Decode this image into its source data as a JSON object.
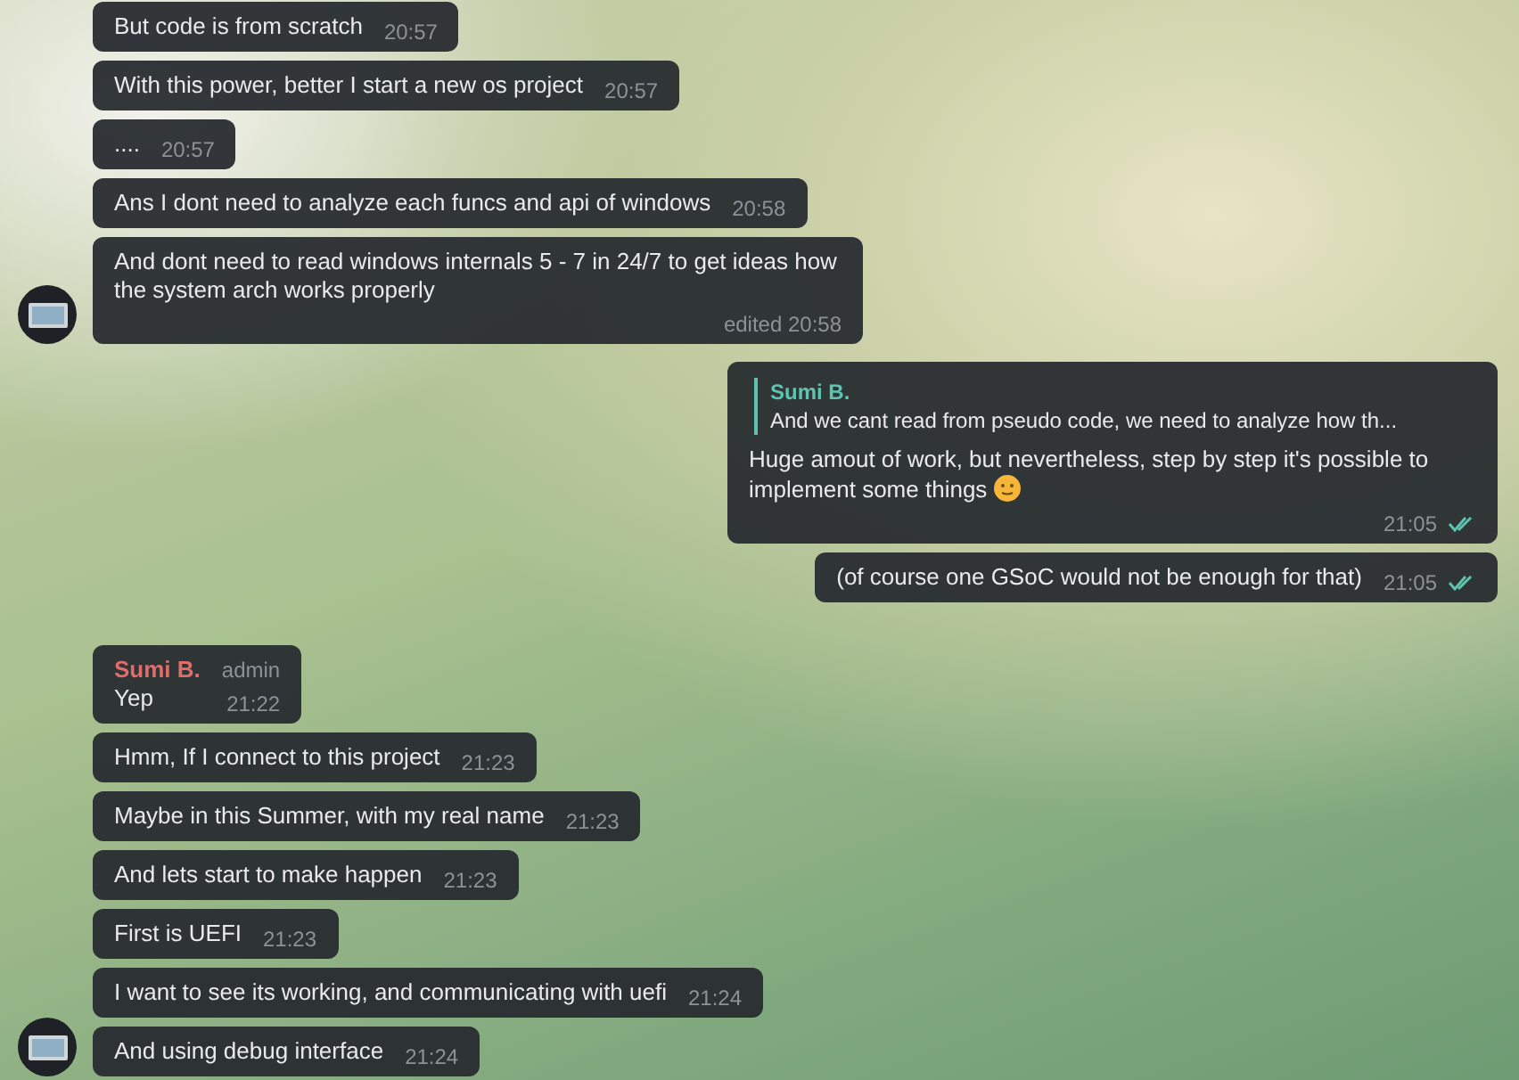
{
  "groups": [
    {
      "kind": "incoming",
      "messages": [
        {
          "text": "But code is from scratch",
          "time": "20:57"
        },
        {
          "text": "With this power, better I start a new os project",
          "time": "20:57"
        },
        {
          "text": "....",
          "time": "20:57"
        },
        {
          "text": "Ans I dont need to analyze each funcs and api of windows",
          "time": "20:58"
        },
        {
          "text": "And dont need to read windows internals 5 - 7 in 24/7 to get ideas how the system arch works properly",
          "time": "edited 20:58"
        }
      ]
    },
    {
      "kind": "outgoing",
      "messages": [
        {
          "reply": {
            "sender": "Sumi B.",
            "text": "And we cant read from pseudo code, we need to analyze how th..."
          },
          "text": "Huge amout of work, but nevertheless, step by step it's possible to implement some things",
          "emoji": true,
          "time": "21:05",
          "read": true
        },
        {
          "text": "(of course one GSoC would not be enough for that)",
          "time": "21:05",
          "read": true
        }
      ]
    },
    {
      "kind": "incoming",
      "messages": [
        {
          "sender": "Sumi B.",
          "badge": "admin",
          "text": "Yep",
          "time": "21:22"
        },
        {
          "text": "Hmm, If I connect to this project",
          "time": "21:23"
        },
        {
          "text": "Maybe in this Summer, with my real name",
          "time": "21:23"
        },
        {
          "text": "And lets start to make happen",
          "time": "21:23"
        },
        {
          "text": "First is UEFI",
          "time": "21:23"
        },
        {
          "text": "I want to see its working, and communicating with uefi",
          "time": "21:24"
        },
        {
          "text": "And using debug interface",
          "time": "21:24"
        }
      ]
    }
  ]
}
